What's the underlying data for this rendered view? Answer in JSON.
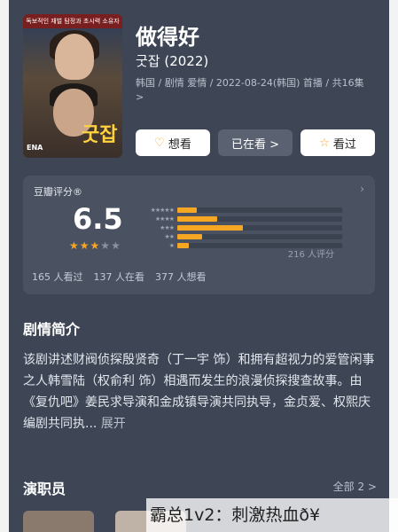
{
  "show": {
    "title": "做得好",
    "subtitle": "굿잡 (2022)",
    "meta": "韩国 / 剧情 爱情 / 2022-08-24(韩国) 首播 / 共16集 >",
    "poster": {
      "banner": "독보적인 재벌 탐정과 초시력 소유자",
      "logo": "굿잡",
      "channel": "ENA"
    }
  },
  "actions": {
    "want_label": "想看",
    "want_icon": "heart-plus-icon",
    "watching_label": "已在看 >",
    "watched_label": "看过",
    "watched_icon": "star-outline-icon"
  },
  "rating": {
    "source": "豆瓣评分®",
    "score": "6.5",
    "stars_on": 3,
    "stars_total": 5,
    "distribution": [
      {
        "stars": "★★★★★",
        "fraction": 0.12
      },
      {
        "stars": "★★★★",
        "fraction": 0.24
      },
      {
        "stars": "★★★",
        "fraction": 0.4
      },
      {
        "stars": "★★",
        "fraction": 0.15
      },
      {
        "stars": "★",
        "fraction": 0.07
      }
    ],
    "total": "216 人评分",
    "stats": {
      "watched": "165 人看过",
      "watching": "137 人在看",
      "want": "377 人想看"
    },
    "accent": "#f5a623"
  },
  "synopsis": {
    "heading": "剧情简介",
    "text": "该剧讲述财阀侦探殷贤奇（丁一宇 饰）和拥有超视力的爱管闲事之人韩雪陆（权俞利 饰）相遇而发生的浪漫侦探搜查故事。由《复仇吧》姜民求导演和金成镇导演共同执导，金贞爱、权熙庆编剧共同执",
    "ellipsis": "...",
    "more": "展开"
  },
  "cast": {
    "heading": "演职员",
    "all": "全部 2 >"
  },
  "watermark": "霸总1v2：刺激热血ð¥"
}
